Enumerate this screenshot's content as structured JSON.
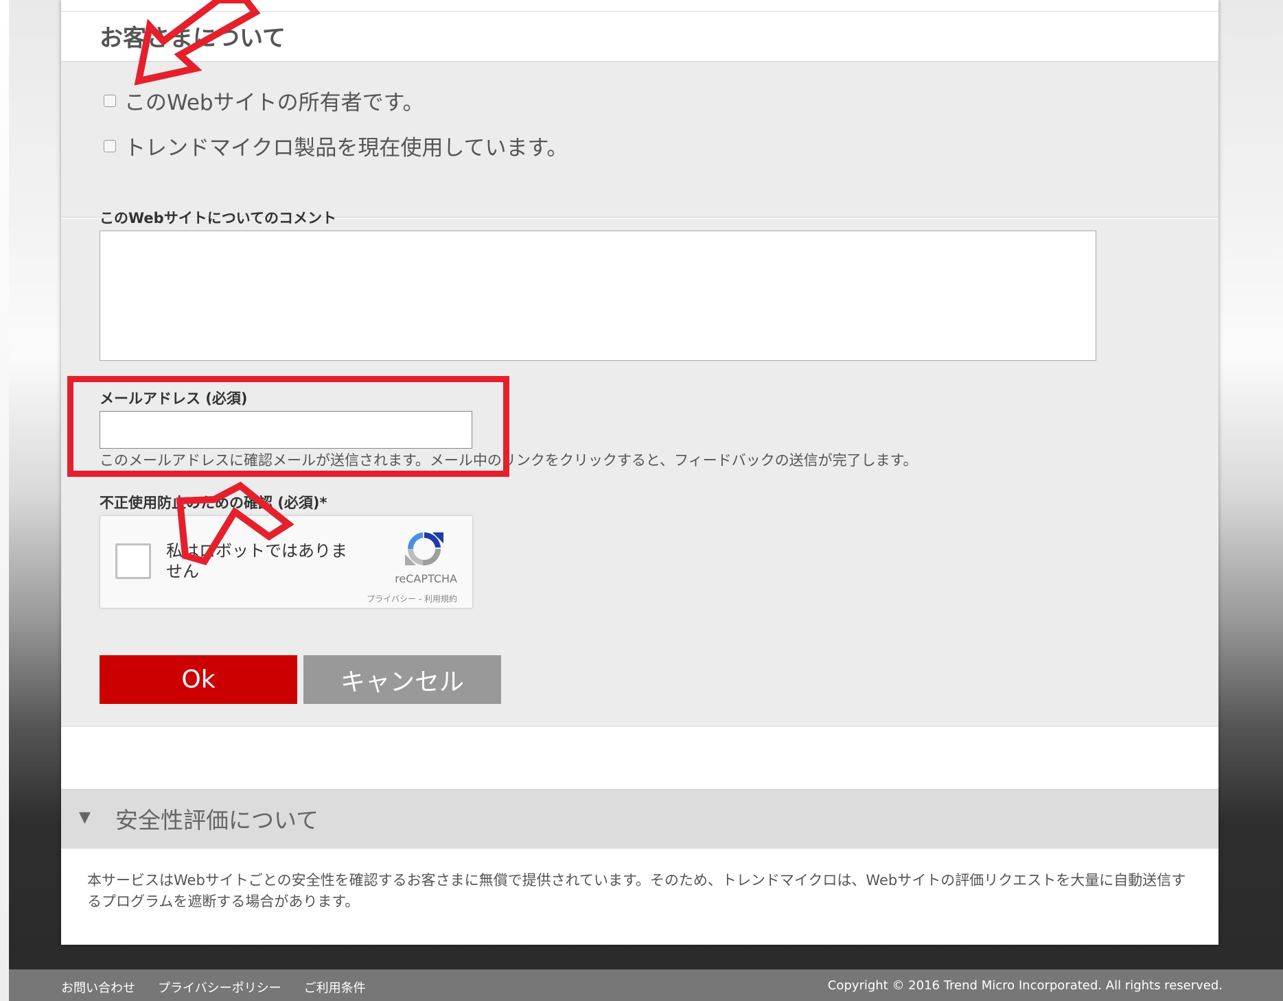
{
  "section": {
    "title": "お客さまについて",
    "checkbox_owner": "このWebサイトの所有者です。",
    "checkbox_product": "トレンドマイクロ製品を現在使用しています。"
  },
  "form": {
    "comment_label": "このWebサイトについてのコメント",
    "comment_value": "",
    "email_label": "メールアドレス (必須)",
    "email_value": "",
    "email_help": "このメールアドレスに確認メールが送信されます。メール中のリンクをクリックすると、フィードバックの送信が完了します。",
    "captcha_label": "不正使用防止のための確認 (必須)*",
    "captcha_text": "私はロボットではありません",
    "captcha_brand": "reCAPTCHA",
    "captcha_terms": "プライバシー - 利用規約",
    "ok_label": "Ok",
    "cancel_label": "キャンセル"
  },
  "safety": {
    "title": "安全性評価について",
    "arrow": "▼",
    "body": "本サービスはWebサイトごとの安全性を確認するお客さまに無償で提供されています。そのため、トレンドマイクロは、Webサイトの評価リクエストを大量に自動送信するプログラムを遮断する場合があります。"
  },
  "footer": {
    "links": [
      "お問い合わせ",
      "プライバシーポリシー",
      "ご利用条件"
    ],
    "copyright": "Copyright © 2016 Trend Micro Incorporated. All rights reserved."
  },
  "colors": {
    "accent": "#cc0000",
    "annotation": "#e5202c",
    "cancel": "#999999"
  }
}
